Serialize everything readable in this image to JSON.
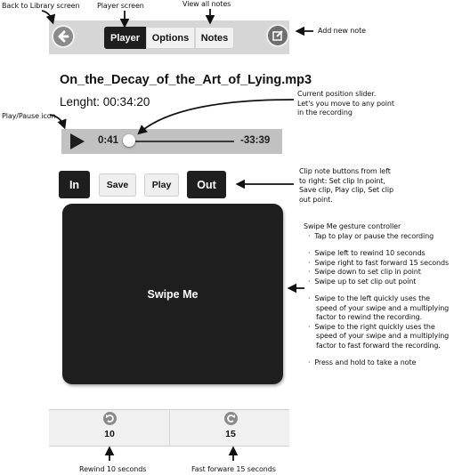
{
  "navbar": {
    "back_icon": "back-arrow-circle-icon",
    "tabs": [
      {
        "label": "Player",
        "active": true
      },
      {
        "label": "Options",
        "active": false
      },
      {
        "label": "Notes",
        "active": false
      }
    ],
    "compose_icon": "compose-note-icon"
  },
  "recording": {
    "title": "On_the_Decay_of_the_Art_of_Lying.mp3",
    "length": "Lenght: 00:34:20"
  },
  "player": {
    "play_icon": "play-icon",
    "elapsed": "0:41",
    "remaining": "-33:39",
    "progress_fraction": 0.02
  },
  "clip_buttons": [
    {
      "label": "In",
      "style": "dark"
    },
    {
      "label": "Save",
      "style": "light"
    },
    {
      "label": "Play",
      "style": "light"
    },
    {
      "label": "Out",
      "style": "dark"
    }
  ],
  "swipe_pad": {
    "label": "Swipe Me"
  },
  "skip_bar": {
    "rewind": {
      "icon": "rewind-icon",
      "seconds": "10"
    },
    "forward": {
      "icon": "fast-forward-icon",
      "seconds": "15"
    }
  },
  "annotations": {
    "back": "Back to Library screen",
    "player_screen": "Player screen",
    "view_notes": "View all notes",
    "add_note": "Add new note",
    "play_pause": "Play/Pause icon",
    "slider": [
      "Current position slider.",
      "Let's you move to any point",
      "in the recording"
    ],
    "clip_buttons": [
      "Clip note buttons from left",
      "to right: Set clip In point,",
      "Save clip, Play clip, Set clip",
      "out point."
    ],
    "swipe_title": "Swipe Me gesture controller",
    "swipe_bullets": [
      "Tap to play or pause the recording",
      "Swipe left to rewind 10 seconds",
      "Swipe right to fast forward 15 seconds",
      "Swipe down to set clip in point",
      "Swipe up to set clip out point",
      "Swipe to the left quickly uses the speed of your swipe and a multiplying factor to rewind the recording.",
      "Swipe to the right quickly uses the speed of your swipe and a multiplying factor to fast forward the recording.",
      "Press and hold to take a note"
    ],
    "rewind": "Rewind 10 seconds",
    "forward": "Fast forware 15 seconds"
  },
  "colors": {
    "dark": "#1e1e1e",
    "navbar_bg": "#d6d6d6",
    "player_bg": "#c1c1c1",
    "light_btn": "#efefef"
  }
}
